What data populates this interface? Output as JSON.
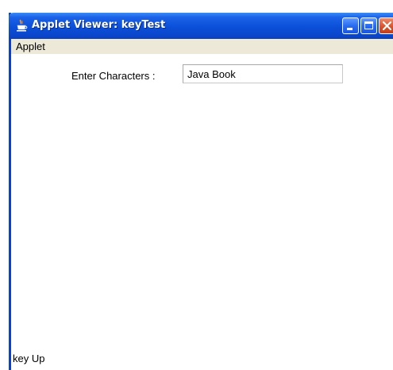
{
  "window": {
    "title": "Applet Viewer: keyTest",
    "menu": [
      "Applet"
    ]
  },
  "form": {
    "label": "Enter Characters :",
    "input_value": "Java Book"
  },
  "status": {
    "text": "key Up"
  },
  "colors": {
    "title_bar": "#0a47cc",
    "close_button": "#d9532c",
    "menubar": "#ece9d8"
  },
  "icons": {
    "title": "java-cup-icon",
    "minimize": "minimize-icon",
    "maximize": "maximize-icon",
    "close": "close-icon"
  }
}
